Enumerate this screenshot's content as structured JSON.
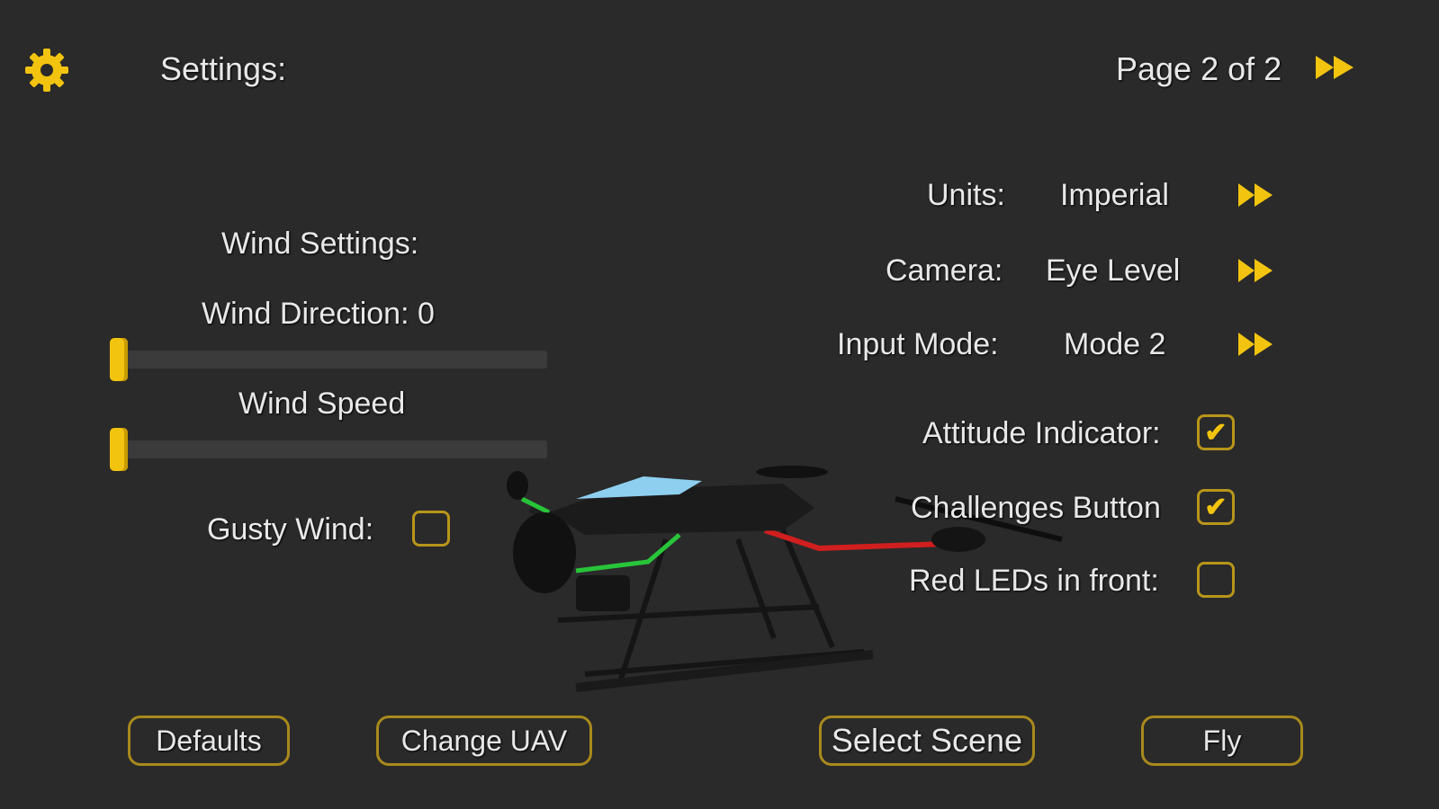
{
  "header": {
    "title": "Settings:",
    "page_indicator": "Page 2 of 2",
    "gear_icon": "gear-icon",
    "next_icon": "fast-forward-icon"
  },
  "wind": {
    "heading": "Wind Settings:",
    "direction_label": "Wind Direction: 0",
    "direction_value": 0,
    "speed_label": "Wind Speed",
    "speed_value": 0,
    "gusty_label": "Gusty Wind:",
    "gusty_checked": false
  },
  "options": {
    "units_label": "Units:",
    "units_value": "Imperial",
    "camera_label": "Camera:",
    "camera_value": "Eye Level",
    "input_label": "Input Mode:",
    "input_value": "Mode 2"
  },
  "toggles": {
    "attitude_label": "Attitude Indicator:",
    "attitude_checked": true,
    "challenges_label": "Challenges Button",
    "challenges_checked": true,
    "redleds_label": "Red LEDs in front:",
    "redleds_checked": false
  },
  "buttons": {
    "defaults": "Defaults",
    "change_uav": "Change UAV",
    "select_scene": "Select Scene",
    "fly": "Fly"
  },
  "colors": {
    "accent": "#f2c40f",
    "border": "#a8891c",
    "background": "#2a2a2a"
  }
}
